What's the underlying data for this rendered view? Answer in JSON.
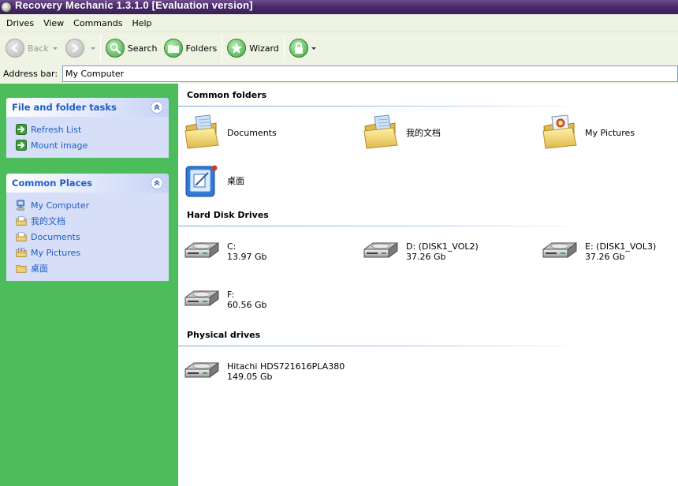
{
  "window": {
    "title": "Recovery Mechanic 1.3.1.0 [Evaluation version]"
  },
  "menu": {
    "items": [
      "Drives",
      "View",
      "Commands",
      "Help"
    ]
  },
  "toolbar": {
    "back_label": "Back",
    "search_label": "Search",
    "folders_label": "Folders",
    "wizard_label": "Wizard"
  },
  "address": {
    "label": "Address bar:",
    "value": "My Computer"
  },
  "left_panel": {
    "tasks": {
      "title": "File and folder tasks",
      "items": [
        {
          "label": "Refresh List",
          "icon": "arrow-right-icon"
        },
        {
          "label": "Mount image",
          "icon": "arrow-right-icon"
        }
      ]
    },
    "places": {
      "title": "Common Places",
      "items": [
        {
          "label": "My Computer",
          "icon": "computer-icon"
        },
        {
          "label": "我的文档",
          "icon": "folder-icon"
        },
        {
          "label": "Documents",
          "icon": "folder-icon"
        },
        {
          "label": "My Pictures",
          "icon": "pictures-folder-icon"
        },
        {
          "label": "桌面",
          "icon": "folder-icon"
        }
      ]
    }
  },
  "content": {
    "common_folders": {
      "title": "Common folders",
      "items": [
        {
          "name": "Documents"
        },
        {
          "name": "我的文档"
        },
        {
          "name": "My Pictures"
        },
        {
          "name": "桌面"
        }
      ]
    },
    "hard_disks": {
      "title": "Hard Disk Drives",
      "items": [
        {
          "name": "C:",
          "size": "13.97 Gb"
        },
        {
          "name": "D: (DISK1_VOL2)",
          "size": "37.26 Gb"
        },
        {
          "name": "E: (DISK1_VOL3)",
          "size": "37.26 Gb"
        },
        {
          "name": "F:",
          "size": "60.56 Gb"
        }
      ]
    },
    "physical": {
      "title": "Physical drives",
      "items": [
        {
          "name": "Hitachi HDS721616PLA380",
          "size": "149.05 Gb"
        }
      ]
    }
  },
  "colors": {
    "left_panel_bg": "#4cbd5a",
    "task_header_text": "#215dc6",
    "titlebar": "#4a2b6a",
    "toolbar_bg": "#eef3e3"
  }
}
